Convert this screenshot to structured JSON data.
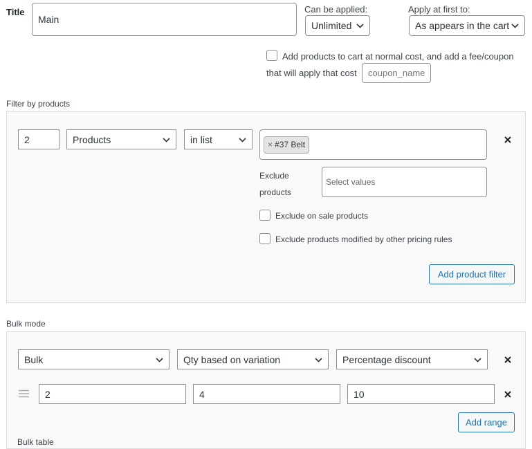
{
  "title": {
    "label": "Title",
    "value": "Main"
  },
  "applied": {
    "label": "Can be applied:",
    "value": "Unlimited"
  },
  "apply_first": {
    "label": "Apply at first to:",
    "value": "As appears in the cart"
  },
  "fee_coupon": {
    "text_line1": "Add products to cart at normal cost, and add a fee/coupon",
    "text_line2": "that will apply that cost",
    "placeholder": "coupon_name"
  },
  "filter": {
    "section_label": "Filter by products",
    "qty": "2",
    "type": "Products",
    "method": "in list",
    "tag": "#37 Belt",
    "tag_remove": "×",
    "exclude_label_1": "Exclude",
    "exclude_label_2": "products",
    "exclude_placeholder": "Select values",
    "exclude_on_sale": "Exclude on sale products",
    "exclude_modified": "Exclude products modified by other pricing rules",
    "add_button": "Add product filter"
  },
  "bulk": {
    "section_label": "Bulk mode",
    "mode": "Bulk",
    "qty_basis": "Qty based on variation",
    "discount_type": "Percentage discount",
    "range_from": "2",
    "range_to": "4",
    "range_value": "10",
    "add_range": "Add range",
    "cut_label": "Bulk table"
  },
  "colors": {
    "accent": "#2271b1",
    "border": "#8c8f94",
    "panel": "#f9f9f9"
  },
  "icons": {
    "dropdown": "chevron-down-icon",
    "remove": "close-icon",
    "drag": "drag-handle-icon"
  }
}
